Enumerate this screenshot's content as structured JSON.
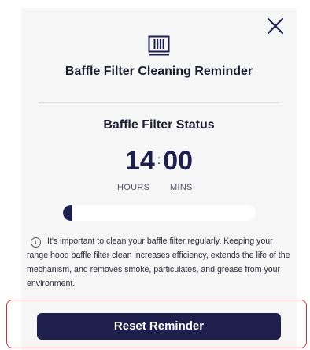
{
  "dialog": {
    "title": "Baffle Filter Cleaning Reminder",
    "close_icon": "close-icon",
    "header_icon": "baffle-filter-icon"
  },
  "status": {
    "title": "Baffle Filter Status",
    "hours": "14",
    "separator": ":",
    "minutes": "00",
    "hours_label": "HOURS",
    "minutes_label": "MINS",
    "progress_fraction": 0.05
  },
  "info": {
    "icon": "info-icon",
    "icon_glyph": "i",
    "text": "It's important to clean your baffle filter regularly. Keeping your range hood baffle filter clean increases efficiency, extends the life of the mechanism, and removes smoke, particulates, and grease from your environment."
  },
  "actions": {
    "reset_label": "Reset Reminder"
  },
  "colors": {
    "primary": "#1e1f4c",
    "panel_background": "#f6f6f7",
    "highlight_border": "#c4323c"
  }
}
